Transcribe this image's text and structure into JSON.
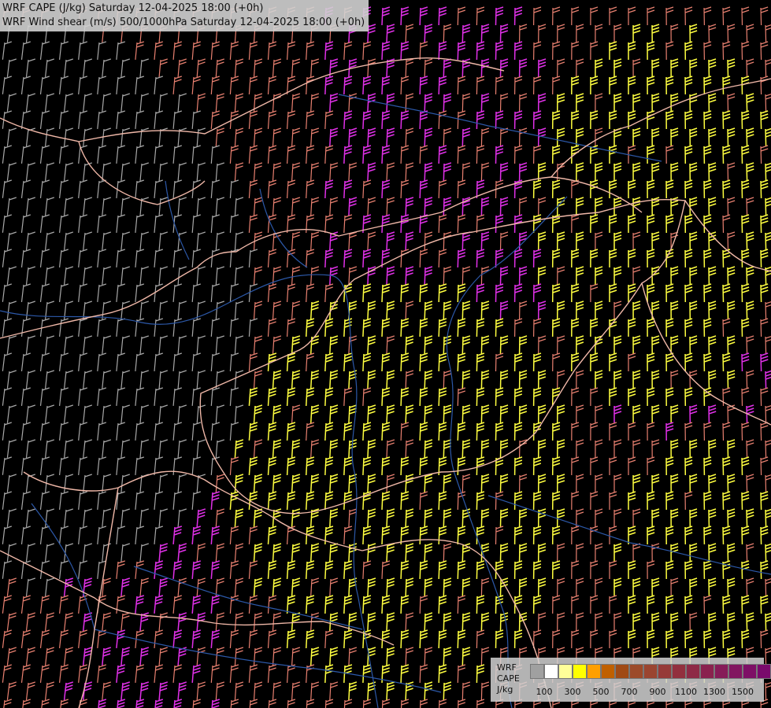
{
  "title": {
    "line1": "WRF CAPE (J/kg) Saturday 12-04-2025 18:00 (+0h)",
    "line2": "WRF Wind shear (m/s) 500/1000hPa Saturday 12-04-2025 18:00 (+0h)"
  },
  "legend": {
    "name_line1": "WRF",
    "name_line2": "CAPE",
    "unit": "J/kg",
    "colors": [
      "#a0a0a0",
      "#ffffff",
      "#ffff99",
      "#ffff00",
      "#ff9f00",
      "#c06000",
      "#a04a15",
      "#9c4a2a",
      "#9a4530",
      "#963a38",
      "#92303e",
      "#8e2a46",
      "#8a224e",
      "#861c58",
      "#821660",
      "#7e1066",
      "#7a0a6c",
      "#76047a"
    ],
    "ticks": [
      "100",
      "300",
      "500",
      "700",
      "900",
      "1100",
      "1300",
      "1500"
    ]
  },
  "colors": {
    "background": "#000000",
    "border_lines": "#f0b8a8",
    "rivers": "#2c58a8",
    "low_shear": "#a8a8a8",
    "moderate_shear": "#e88070",
    "high_shear": "#e030e8",
    "very_high_shear": "#ffff40"
  }
}
